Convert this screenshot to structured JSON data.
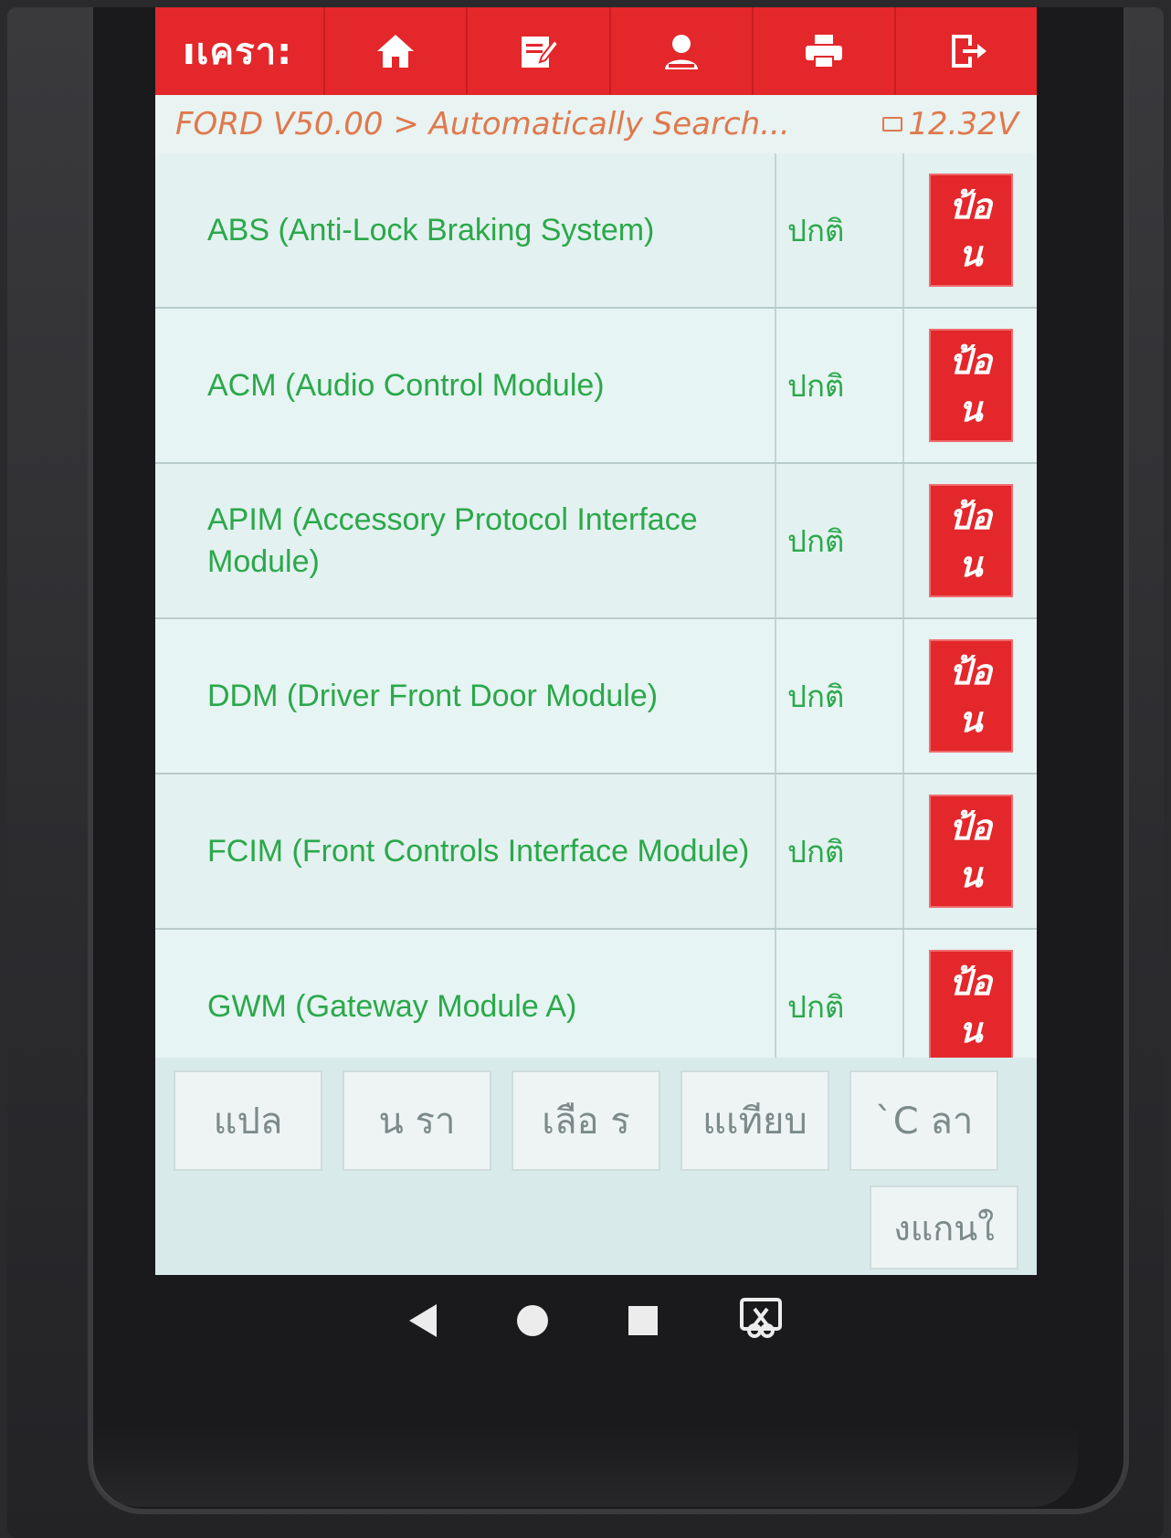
{
  "toolbar": {
    "title": "ıเครา:",
    "icons": [
      "home-icon",
      "edit-icon",
      "user-icon",
      "print-icon",
      "exit-icon"
    ]
  },
  "breadcrumb": {
    "path": "FORD V50.00 > Automatically Search...",
    "voltage": "12.32V"
  },
  "modules": [
    {
      "name": "ABS (Anti-Lock Braking System)",
      "status": "ปกติ",
      "action_line1": "ป้อ",
      "action_line2": "น"
    },
    {
      "name": "ACM (Audio Control Module)",
      "status": "ปกติ",
      "action_line1": "ป้อ",
      "action_line2": "น"
    },
    {
      "name": "APIM (Accessory Protocol Interface Module)",
      "status": "ปกติ",
      "action_line1": "ป้อ",
      "action_line2": "น"
    },
    {
      "name": "DDM (Driver Front Door Module)",
      "status": "ปกติ",
      "action_line1": "ป้อ",
      "action_line2": "น"
    },
    {
      "name": "FCIM (Front Controls Interface Module)",
      "status": "ปกติ",
      "action_line1": "ป้อ",
      "action_line2": "น"
    },
    {
      "name": "GWM (Gateway Module A)",
      "status": "ปกติ",
      "action_line1": "ป้อ",
      "action_line2": "น"
    }
  ],
  "bottom_buttons": [
    "แปล",
    "น   รา",
    "เลือ   ร",
    "แเทียบ",
    "ˋC   ลา"
  ],
  "scan_button": "งแกนใ",
  "colors": {
    "toolbar": "#e3272b",
    "accent_text": "#2ba84a",
    "breadcrumb_text": "#e0784c",
    "screen_bg": "#e3f2f1"
  }
}
